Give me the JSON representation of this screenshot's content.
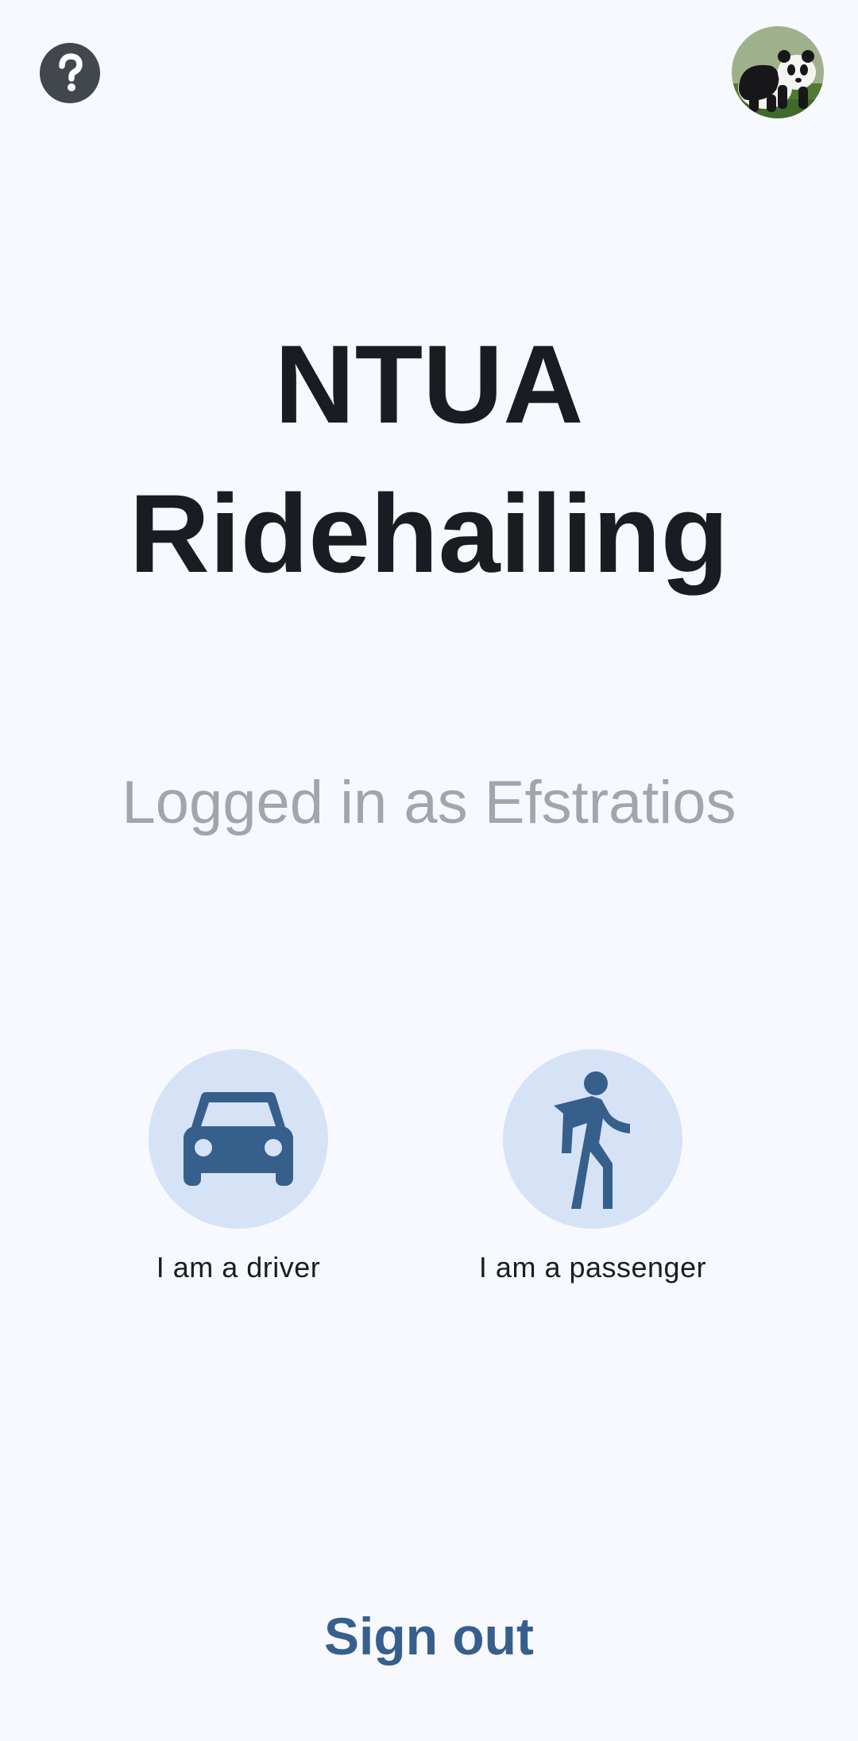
{
  "header": {
    "help_icon": "help-circle-icon",
    "avatar_icon": "panda-avatar"
  },
  "title": {
    "line1": "NTUA",
    "line2": "Ridehailing"
  },
  "status": {
    "logged_in_text": "Logged in as Efstratios"
  },
  "roles": {
    "driver": {
      "label": "I am a driver",
      "icon": "car-icon"
    },
    "passenger": {
      "label": "I am a passenger",
      "icon": "walking-person-icon"
    }
  },
  "actions": {
    "sign_out_label": "Sign out"
  },
  "colors": {
    "background": "#f8f9fe",
    "primary": "#365f8c",
    "icon_circle": "#d6e3f7",
    "title": "#191c20",
    "subtitle": "#a2a5ab",
    "help_button": "#41474d"
  }
}
